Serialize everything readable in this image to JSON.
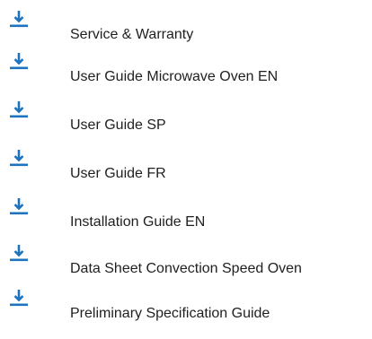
{
  "downloads": {
    "icon": "download-arrow-icon",
    "accent_color": "#1e73be",
    "items": [
      {
        "label": "Service & Warranty"
      },
      {
        "label": "User Guide Microwave Oven EN"
      },
      {
        "label": "User Guide SP"
      },
      {
        "label": "User Guide FR"
      },
      {
        "label": "Installation Guide EN"
      },
      {
        "label": "Data Sheet Convection Speed Oven"
      },
      {
        "label": "Preliminary Specification Guide"
      }
    ]
  }
}
